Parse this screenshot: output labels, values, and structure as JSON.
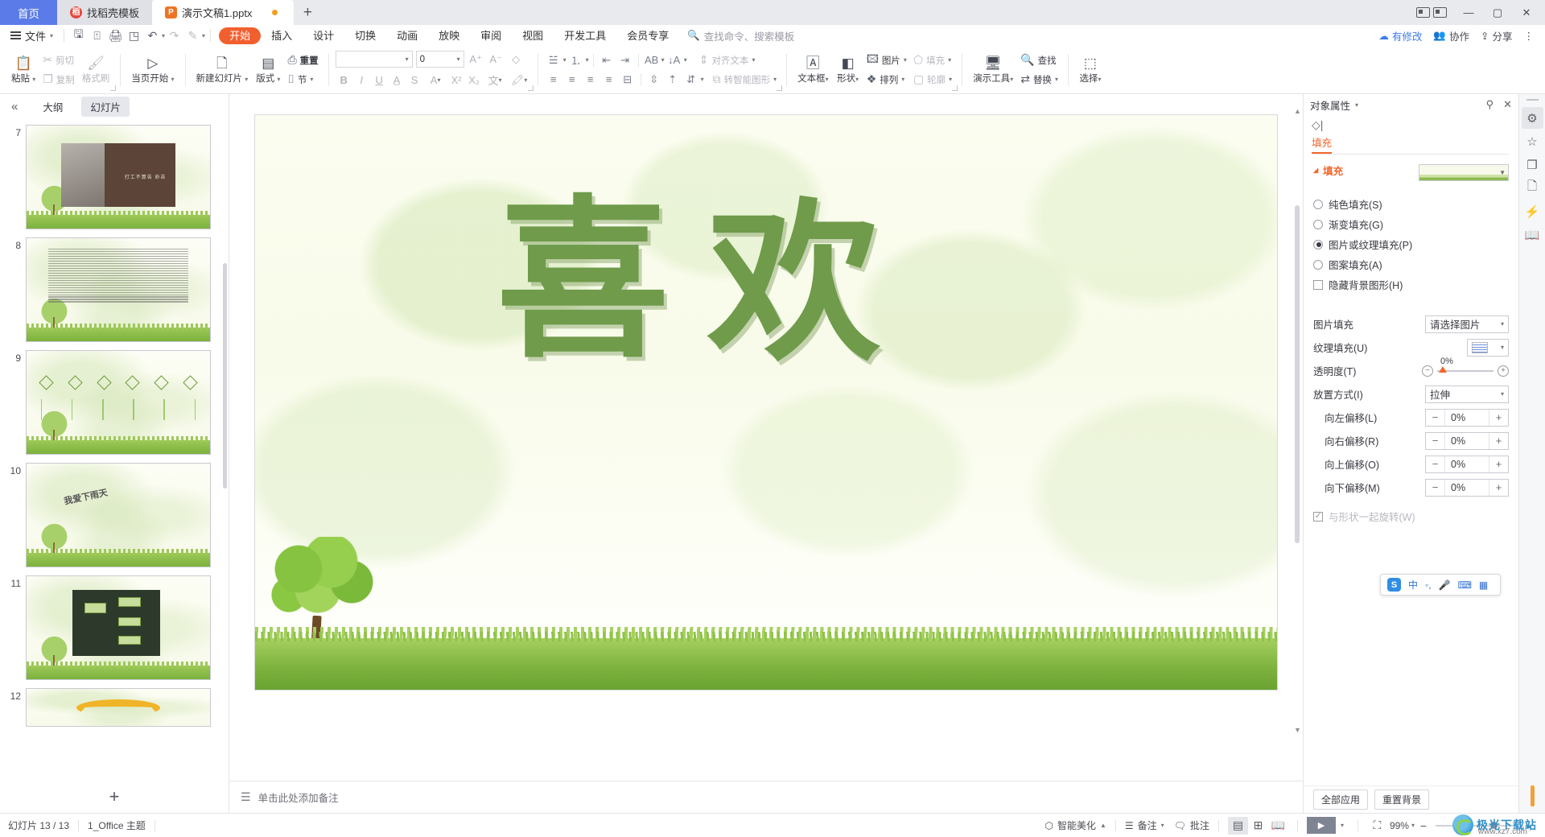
{
  "window": {
    "tabs": [
      {
        "label": "首页",
        "kind": "home"
      },
      {
        "label": "找稻壳模板",
        "kind": "template",
        "icon": "dao-icon"
      },
      {
        "label": "演示文稿1.pptx",
        "kind": "document",
        "icon": "ppt-icon",
        "modified": true
      }
    ],
    "new_tab": "+",
    "controls": {
      "minimize": "—",
      "maximize": "▢",
      "close": "✕"
    }
  },
  "menubar": {
    "file_label": "文件",
    "quick_access": [
      "save-icon",
      "save-as-icon",
      "print-icon",
      "print-preview-icon",
      "undo-icon",
      "redo-icon",
      "format-painter-icon",
      "customize-icon"
    ],
    "items": [
      "开始",
      "插入",
      "设计",
      "切换",
      "动画",
      "放映",
      "审阅",
      "视图",
      "开发工具",
      "会员专享"
    ],
    "active": "开始",
    "search_placeholder": "查找命令、搜索模板",
    "right_items": [
      {
        "label": "有修改",
        "icon": "cloud-icon",
        "accent": "#3d7cf0"
      },
      {
        "label": "协作",
        "icon": "collab-icon"
      },
      {
        "label": "分享",
        "icon": "share-icon"
      },
      {
        "label": "",
        "icon": "more-icon"
      }
    ]
  },
  "ribbon": {
    "groups": [
      {
        "name": "clipboard",
        "big": [
          {
            "label": "粘贴",
            "icon": "paste-icon",
            "dropdown": true
          }
        ],
        "small": [
          {
            "label": "剪切",
            "icon": "scissors-icon",
            "disabled": true
          },
          {
            "label": "复制",
            "icon": "copy-icon",
            "disabled": true
          },
          {
            "label": "格式刷",
            "icon": "brush-icon",
            "disabled": true
          }
        ]
      },
      {
        "name": "slideshow",
        "big": [
          {
            "label": "当页开始",
            "icon": "play-circle-icon",
            "dropdown": true
          }
        ]
      },
      {
        "name": "slides",
        "big": [
          {
            "label": "新建幻灯片",
            "icon": "new-slide-icon",
            "dropdown": true
          },
          {
            "label": "版式",
            "icon": "layout-icon",
            "dropdown": true
          }
        ],
        "small": [
          {
            "label": "重置",
            "icon": "reset-icon"
          },
          {
            "label": "节",
            "icon": "section-icon",
            "dropdown": true
          }
        ]
      },
      {
        "name": "font",
        "font_name": "",
        "font_size": "0",
        "buttons_row1": [
          "A⁺",
          "A⁻",
          "clear-format-icon"
        ],
        "buttons_row2": [
          "B",
          "I",
          "U",
          "A-char-icon",
          "S",
          "A-color-icon",
          "X²",
          "X₂",
          "wen-icon",
          "highlight-icon"
        ]
      },
      {
        "name": "paragraph",
        "row1": [
          "bullets-icon",
          "numbering-icon",
          "decrease-indent-icon",
          "increase-indent-icon",
          "text-direction-icon",
          "line-sort-icon"
        ],
        "row1_label": "对齐文本",
        "row2": [
          "align-left-icon",
          "align-center-icon",
          "align-right-icon",
          "justify-icon",
          "distribute-icon",
          "line-spacing-icon",
          "para-space-before-icon",
          "para-space-icon"
        ],
        "row2_label": "转智能图形"
      },
      {
        "name": "drawing",
        "big": [
          {
            "label": "文本框",
            "icon": "textbox-icon",
            "dropdown": true
          },
          {
            "label": "形状",
            "icon": "shapes-icon",
            "dropdown": true
          }
        ],
        "small": [
          {
            "label": "图片",
            "icon": "picture-icon",
            "dropdown": true
          },
          {
            "label": "填充",
            "icon": "fill-icon",
            "dropdown": true,
            "disabled": true
          },
          {
            "label": "排列",
            "icon": "arrange-icon",
            "dropdown": true
          },
          {
            "label": "轮廓",
            "icon": "outline-icon",
            "dropdown": true,
            "disabled": true
          }
        ]
      },
      {
        "name": "tools",
        "big": [
          {
            "label": "演示工具",
            "icon": "present-tool-icon",
            "dropdown": true
          }
        ],
        "small": [
          {
            "label": "查找",
            "icon": "search-icon"
          },
          {
            "label": "替换",
            "icon": "replace-icon",
            "dropdown": true
          }
        ]
      },
      {
        "name": "select",
        "big": [
          {
            "label": "选择",
            "icon": "select-icon",
            "dropdown": true
          }
        ]
      }
    ]
  },
  "thumbnails": {
    "collapse_icon": "collapse-left-icon",
    "view_tabs": [
      {
        "label": "大纲",
        "selected": false
      },
      {
        "label": "幻灯片",
        "selected": true
      }
    ],
    "slides": [
      {
        "number": "7",
        "type": "image-slide",
        "caption": "打工不算苦 命苦"
      },
      {
        "number": "8",
        "type": "text-slide"
      },
      {
        "number": "9",
        "type": "diamond-row-slide"
      },
      {
        "number": "10",
        "type": "title-slide",
        "caption": "我爱下雨天"
      },
      {
        "number": "11",
        "type": "org-chart-slide"
      },
      {
        "number": "12",
        "type": "arc-slide"
      }
    ],
    "add_slide": "+"
  },
  "slide": {
    "wordart": [
      "喜",
      "欢"
    ],
    "wordart_color": "#6f9b4b",
    "background": "green-leaves-grass-template"
  },
  "notes": {
    "placeholder": "单击此处添加备注",
    "icon": "notes-icon"
  },
  "right_panel": {
    "title": "对象属性",
    "pin_icon": "pin-icon",
    "close_icon": "close-icon",
    "shape_icon": "shape-properties-icon",
    "tab": "填充",
    "section_title": "填充",
    "fill_preview": "green-gradient-thumbnail",
    "radio_options": [
      {
        "label": "纯色填充(S)",
        "selected": false
      },
      {
        "label": "渐变填充(G)",
        "selected": false
      },
      {
        "label": "图片或纹理填充(P)",
        "selected": true
      },
      {
        "label": "图案填充(A)",
        "selected": false
      }
    ],
    "checkbox": {
      "label": "隐藏背景图形(H)",
      "checked": false
    },
    "fields": [
      {
        "label": "图片填充",
        "type": "select",
        "value": "请选择图片"
      },
      {
        "label": "纹理填充(U)",
        "type": "texture-select",
        "value": ""
      },
      {
        "label": "透明度(T)",
        "type": "slider",
        "value": "0%"
      },
      {
        "label": "放置方式(I)",
        "type": "select",
        "value": "拉伸"
      },
      {
        "label": "向左偏移(L)",
        "type": "spinner",
        "value": "0%",
        "indent": true
      },
      {
        "label": "向右偏移(R)",
        "type": "spinner",
        "value": "0%",
        "indent": true
      },
      {
        "label": "向上偏移(O)",
        "type": "spinner",
        "value": "0%",
        "indent": true
      },
      {
        "label": "向下偏移(M)",
        "type": "spinner",
        "value": "0%",
        "indent": true
      }
    ],
    "rotate_with_shape": {
      "label": "与形状一起旋转(W)",
      "checked": true,
      "disabled": true
    },
    "footer_buttons": [
      "全部应用",
      "重置背景"
    ]
  },
  "rail": {
    "items": [
      {
        "icon": "properties-icon",
        "selected": true
      },
      {
        "icon": "star-icon",
        "selected": false
      },
      {
        "icon": "duplicate-icon",
        "selected": false
      },
      {
        "icon": "design-idea-icon",
        "selected": false
      },
      {
        "icon": "lightning-icon",
        "selected": false
      },
      {
        "icon": "book-search-icon",
        "selected": false
      }
    ]
  },
  "statusbar": {
    "slide_count": "幻灯片 13 / 13",
    "theme": "1_Office 主题",
    "right_items": [
      {
        "label": "智能美化",
        "icon": "beautify-icon",
        "dropdown": "▲"
      },
      {
        "label": "备注",
        "icon": "notes-icon",
        "dropdown": "▾"
      },
      {
        "label": "批注",
        "icon": "comment-icon"
      }
    ],
    "view_buttons": [
      {
        "icon": "normal-view-icon",
        "selected": true
      },
      {
        "icon": "slide-sorter-icon",
        "selected": false
      },
      {
        "icon": "reading-view-icon",
        "selected": false
      }
    ],
    "play_button": {
      "icon": "play-icon",
      "dropdown": "▾"
    },
    "fit_icon": "fit-to-window-icon",
    "zoom": "99%",
    "zoom_minus": "−",
    "zoom_plus": "+"
  },
  "ime": {
    "logo": "S",
    "items": [
      "中",
      "半角",
      "mic-icon",
      "keyboard-icon",
      "toolbox-icon"
    ]
  },
  "watermark": {
    "title": "极光下载站",
    "url": "www.xz7.com"
  }
}
